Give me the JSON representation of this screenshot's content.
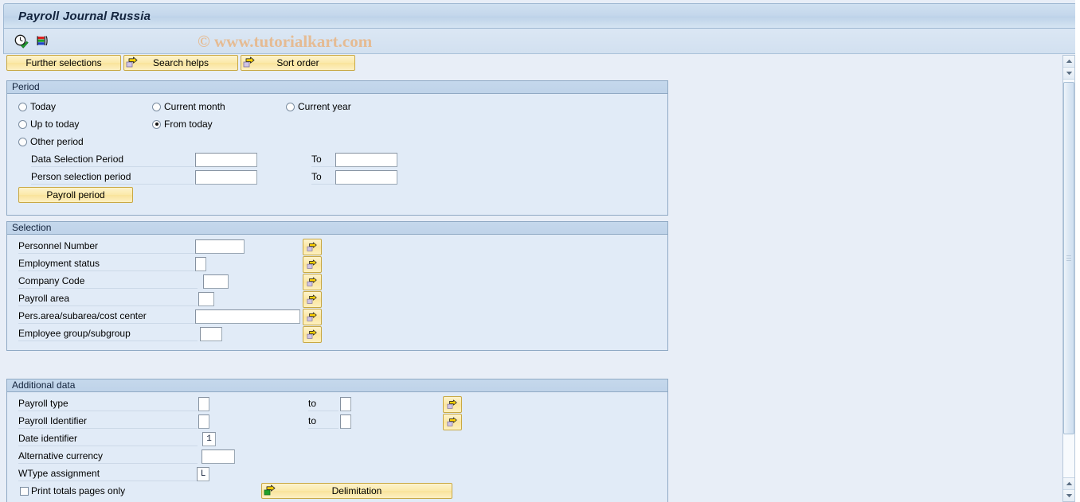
{
  "window": {
    "title": "Payroll Journal Russia",
    "watermark": "© www.tutorialkart.com"
  },
  "toolbar": {
    "icons": [
      {
        "name": "execute-clock-icon",
        "tooltip": "Execute"
      },
      {
        "name": "variant-icon",
        "tooltip": "Get Variant"
      }
    ]
  },
  "buttons": {
    "further_selections": "Further selections",
    "search_helps": "Search helps",
    "sort_order": "Sort order"
  },
  "period": {
    "header": "Period",
    "radios": [
      {
        "label": "Today",
        "selected": false
      },
      {
        "label": "Current month",
        "selected": false
      },
      {
        "label": "Current year",
        "selected": false
      },
      {
        "label": "Up to today",
        "selected": false
      },
      {
        "label": "From today",
        "selected": true
      },
      {
        "label": "Other period",
        "selected": false
      }
    ],
    "rows": [
      {
        "label": "Data Selection Period",
        "value": "",
        "to_label": "To",
        "to_value": ""
      },
      {
        "label": "Person selection period",
        "value": "",
        "to_label": "To",
        "to_value": ""
      }
    ],
    "payroll_period_button": "Payroll period"
  },
  "selection": {
    "header": "Selection",
    "rows": [
      {
        "label": "Personnel Number",
        "value": ""
      },
      {
        "label": "Employment status",
        "value": ""
      },
      {
        "label": "Company Code",
        "value": ""
      },
      {
        "label": "Payroll area",
        "value": ""
      },
      {
        "label": "Pers.area/subarea/cost center",
        "value": ""
      },
      {
        "label": "Employee group/subgroup",
        "value": ""
      }
    ]
  },
  "additional": {
    "header": "Additional data",
    "rows": [
      {
        "label": "Payroll type",
        "value": "",
        "to_label": "to",
        "to_value": ""
      },
      {
        "label": "Payroll Identifier",
        "value": "",
        "to_label": "to",
        "to_value": ""
      },
      {
        "label": "Date identifier",
        "value": "1"
      },
      {
        "label": "Alternative currency",
        "value": ""
      },
      {
        "label": "WType assignment",
        "value": "L"
      }
    ],
    "print_totals_label": "Print totals pages only",
    "print_totals_checked": false,
    "delimitation_button": "Delimitation"
  },
  "colors": {
    "accent_button": "#fbe9a9",
    "panel_bg": "#e1ebf7",
    "panel_border": "#8fa9c4",
    "title_text": "#12233d",
    "watermark": "#e8b583"
  }
}
